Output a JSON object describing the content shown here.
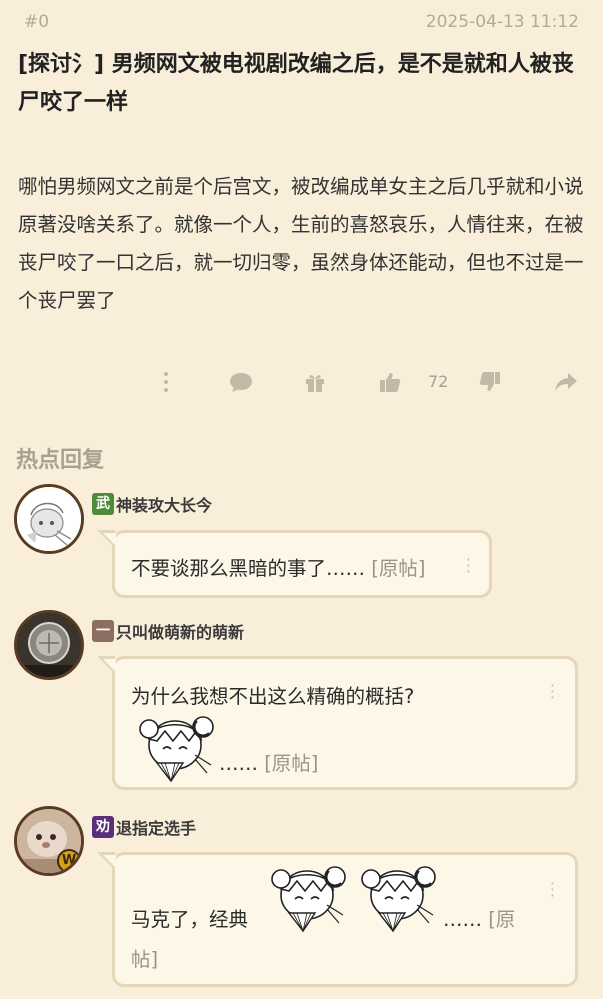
{
  "post": {
    "floor": "#0",
    "time": "2025-04-13 11:12",
    "title": "[探讨氵] 男频网文被电视剧改编之后，是不是就和人被丧尸咬了一样",
    "body": "哪怕男频网文之前是个后宫文，被改编成单女主之后几乎就和小说原著没啥关系了。就像一个人，生前的喜怒哀乐，人情往来，在被丧尸咬了一口之后，就一切归零，虽然身体还能动，但也不过是一个丧尸罢了"
  },
  "actions": {
    "like_count": "72",
    "icons": [
      "more-icon",
      "comment-icon",
      "gift-icon",
      "thumbs-up-icon",
      "thumbs-down-icon",
      "share-icon"
    ]
  },
  "hot_replies": {
    "heading": "热点回复",
    "items": [
      {
        "badge": "武",
        "badge_color": "#4f8a3a",
        "username": "神装攻大长今",
        "text": "不要谈那么黑暗的事了……",
        "orig": "[原帖]"
      },
      {
        "badge": "一",
        "badge_color": "#8d6e63",
        "username": "只叫做萌新的萌新",
        "text": "为什么我想不出这么精确的概括?",
        "orig": "[原帖]",
        "ellipsis": "……"
      },
      {
        "badge": "劝",
        "badge_color": "#5a2f7a",
        "username": "退指定选手",
        "text": "马克了，经典",
        "ellipsis": "……",
        "orig_a": "[原",
        "orig_b": "帖]"
      }
    ]
  }
}
